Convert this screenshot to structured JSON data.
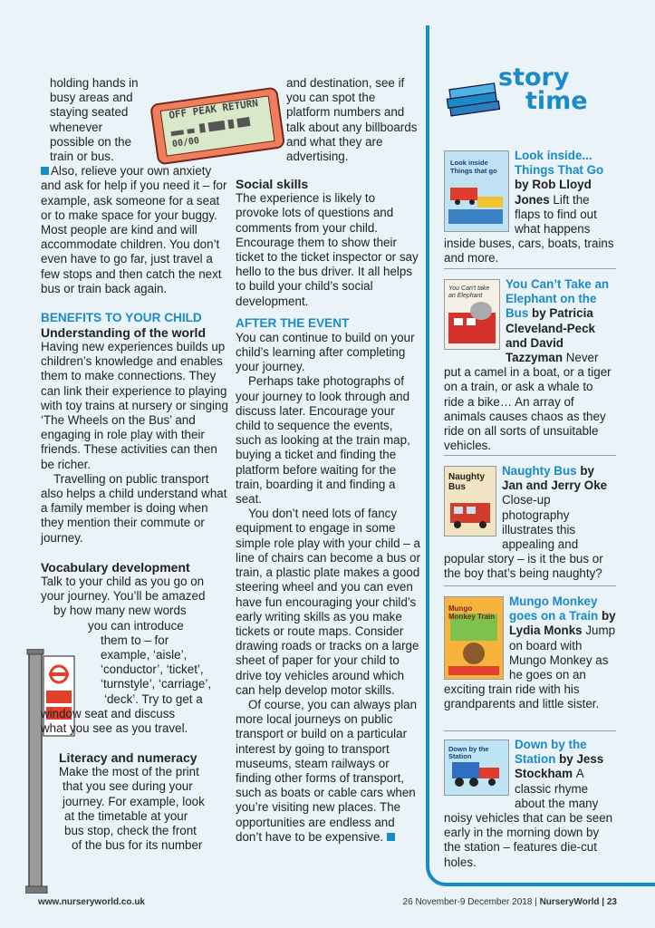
{
  "col1": {
    "p1": "holding hands in busy areas and staying seated whenever possible on the train or bus.",
    "p2": "Also, relieve your own anxiety and ask for help if you need it – for example, ask someone for a seat or to make space for your buggy. Most people are kind and will accommodate children. You don’t even have to go far, just travel a few stops and then catch the next bus or train back again.",
    "heading_benefits": "BENEFITS TO YOUR CHILD",
    "heading_understanding": "Understanding of the world",
    "p3": "Having new experiences builds up children’s knowledge and enables them to make connections. They can link their experience to playing with toy trains at nursery or singing ‘The Wheels on the Bus’ and engaging in role play with their friends. These activities can then be richer.",
    "p4": "Travelling on public transport also helps a child understand what a family member is doing when they mention their commute or journey.",
    "heading_vocab": "Vocabulary development",
    "p5a": "Talk to your child as you go on your journey. You’ll be amazed",
    "p5b": "by how many new words",
    "p5c": "you can introduce",
    "p5d": "them to – for",
    "p5e": "example, ‘aisle’,",
    "p5f": "‘conductor’, ‘ticket’,",
    "p5g": "‘turnstyle’, ‘carriage’,",
    "p5h": "‘deck’. Try to get a",
    "p5i": "window seat and discuss",
    "p5j": "what you see as you travel.",
    "heading_literacy": "Literacy and numeracy",
    "p6a": "Make the most of the print",
    "p6b": "that you see during your",
    "p6c": "journey. For example, look",
    "p6d": "at the timetable at your",
    "p6e": "bus stop, check the front",
    "p6f": "of the bus for its number"
  },
  "ticket": {
    "line1": "OFF PEAK RETURN",
    "line2": "00/00"
  },
  "col2": {
    "p1": "and destination, see if you can spot the platform numbers and talk about any billboards and what they are advertising.",
    "heading_social": "Social skills",
    "p2": "The experience is likely to provoke lots of questions and comments from your child. Encourage them to show their ticket to the ticket inspector or say hello to the bus driver. It all helps to build your child’s social development.",
    "heading_after": "AFTER THE EVENT",
    "p3": "You can continue to build on your child’s learning after completing your journey.",
    "p4": "Perhaps take photographs of your journey to look through and discuss later. Encourage your child to sequence the events, such as looking at the train map, buying a ticket and finding the platform before waiting for the train, boarding it and finding a seat.",
    "p5": "You don’t need lots of fancy equipment to engage in some simple role play with your child – a line of chairs can become a bus or train, a plastic plate makes a good steering wheel and you can even have fun encouraging your child’s early writing skills as you make tickets or route maps. Consider drawing roads or tracks on a large sheet of paper for your child to drive toy vehicles around which can help develop motor skills.",
    "p6": "Of course, you can always plan more local journeys on public transport or build on a particular interest by going to transport museums, steam railways or finding other forms of transport, such as boats or cable cars when you’re visiting new places. The opportunities are endless and don’t have to be expensive."
  },
  "story_time": {
    "word1": "story",
    "word2": "time",
    "books": [
      {
        "title": "Look inside... Things That Go",
        "author": "by Rob Lloyd Jones",
        "desc": "Lift the flaps to find out what happens inside buses, cars, boats, trains and more.",
        "cover_text": "Look inside Things that go"
      },
      {
        "title": "You Can’t Take an Elephant on the Bus",
        "author": "by Patricia Cleveland-Peck and David Tazzyman",
        "desc": "Never put a camel in a boat, or a tiger on a train, or ask a whale to ride a bike… An array of animals causes chaos as they ride on all sorts of unsuitable vehicles.",
        "cover_text": "You Can't take an Elephant"
      },
      {
        "title": "Naughty Bus",
        "author": "by Jan and Jerry Oke",
        "desc": "Close-up photography illustrates this appealing and popular story – is it the bus or the boy that’s being naughty?",
        "cover_text": "Naughty Bus"
      },
      {
        "title": "Mungo Monkey goes on a Train",
        "author": "by Lydia Monks",
        "desc": "Jump on board with Mungo Monkey as he goes on an exciting train ride with his grandparents and little sister.",
        "cover_text": "Mungo Monkey Train"
      },
      {
        "title": "Down by the Station",
        "author": "by Jess Stockham",
        "desc": "A classic rhyme about the many noisy vehicles that can be seen early in the morning down by the station – features die-cut holes.",
        "cover_text": "Down by the Station"
      }
    ]
  },
  "footer": {
    "url": "www.nurseryworld.co.uk",
    "date": "26 November-9 December 2018 |",
    "brand": "NurseryWorld",
    "page": "| 23"
  },
  "colors": {
    "accent": "#1a8bc7",
    "background": "#e9f3f8",
    "ticket": "#f07e5c"
  }
}
